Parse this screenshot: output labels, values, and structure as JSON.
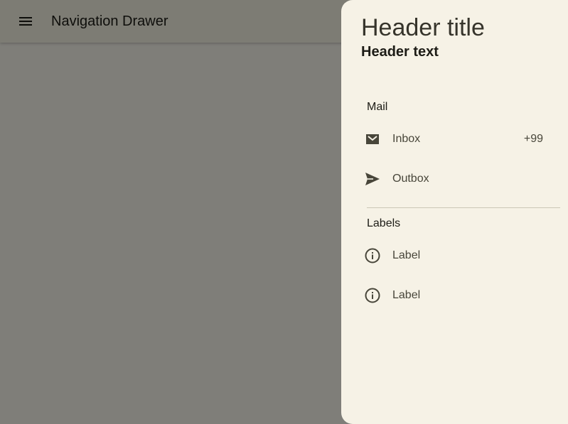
{
  "topbar": {
    "menu_icon": "menu-icon",
    "title": "Navigation Drawer"
  },
  "drawer": {
    "header_title": "Header title",
    "header_text": "Header text",
    "sections": [
      {
        "label": "Mail",
        "items": [
          {
            "label": "Inbox",
            "icon": "mail-icon",
            "badge": "+99"
          },
          {
            "label": "Outbox",
            "icon": "send-icon",
            "badge": ""
          }
        ]
      },
      {
        "label": "Labels",
        "items": [
          {
            "label": "Label",
            "icon": "info-icon",
            "badge": ""
          },
          {
            "label": "Label",
            "icon": "info-icon",
            "badge": ""
          }
        ]
      }
    ]
  },
  "colors": {
    "drawer_background": "#f6f2e6",
    "topbar_background": "#fbf9e9",
    "icon_color": "#48463a"
  }
}
